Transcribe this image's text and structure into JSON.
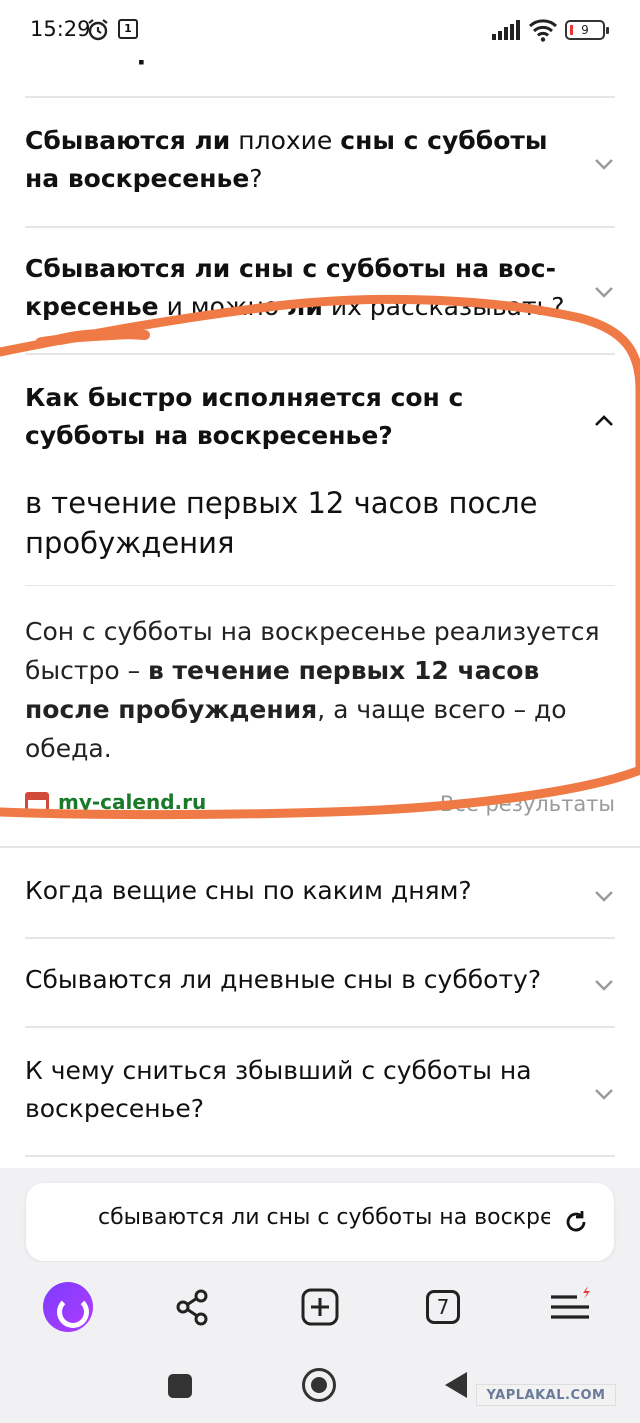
{
  "status_bar": {
    "time": "15:29",
    "notification_badge": "1",
    "battery": "9"
  },
  "top_cut_text": "на воскресенье?",
  "faq": [
    {
      "parts": [
        [
          "b",
          "Сбываются ли"
        ],
        [
          "n",
          " плохие "
        ],
        [
          "b",
          "сны с субботы на воскресенье"
        ],
        [
          "n",
          "?"
        ]
      ]
    },
    {
      "parts": [
        [
          "b",
          "Сбываются ли сны с субботы на вос-кресенье"
        ],
        [
          "n",
          " и можно "
        ],
        [
          "b",
          "ли"
        ],
        [
          "n",
          " их рассказывать?"
        ]
      ]
    },
    {
      "parts": [
        [
          "b",
          "Как быстро исполняется сон с субботы на воскресенье?"
        ]
      ]
    }
  ],
  "answer": {
    "highlight": "в течение первых 12 часов после пробуждения",
    "text_before": "Сон с субботы на воскресенье реализуется быстро – ",
    "text_bold": "в течение первых 12 часов после пробуждения",
    "text_after": ", а чаще всего – до обеда.",
    "source": "my-calend.ru",
    "all_results": "Все результаты"
  },
  "more_faq": [
    "Когда вещие сны по каким дням?",
    "Сбываются ли дневные сны в субботу?",
    "К чему сниться збывший с субботы на воскресенье?"
  ],
  "search": {
    "query": "сбываются ли сны с субботы на воскресенье"
  },
  "bottom_nav": {
    "tabs_count": "7"
  },
  "watermark": "YAPLAKAL.COM",
  "colors": {
    "marker": "#f07a45",
    "source_icon": "#d24a3a",
    "alice": "#8a3cff"
  }
}
